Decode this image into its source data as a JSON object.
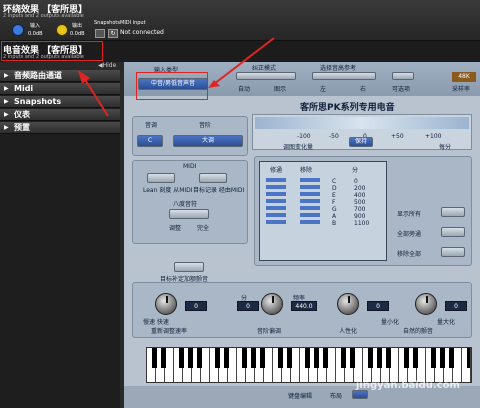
{
  "header": {
    "title1": "环绕效果 【客所思】",
    "subtitle1": "2 inputs and 2 outputs available",
    "input_label": "输入",
    "input_db": "0.0dB",
    "output_label": "输出",
    "output_db": "0.0dB",
    "snapshots_label": "Snapshots",
    "midi_input_label": "MIDI input",
    "midi_status": "Not connected",
    "title2": "电音效果 【客所思】",
    "subtitle2": "2 inputs and 2 outputs available",
    "hide_label": "◀Hide"
  },
  "sidebar": {
    "items": [
      {
        "label": "音频路由通道"
      },
      {
        "label": "Midi"
      },
      {
        "label": "Snapshots"
      },
      {
        "label": "仪表"
      },
      {
        "label": "预置"
      }
    ]
  },
  "plugin": {
    "input_type_label": "输入类型",
    "input_type_value": "中音/男低音声音",
    "correction_mode_label": "纠正模式",
    "auto_label": "自动",
    "graph_label": "图示",
    "select_pitch_label": "选择音高参考",
    "left_label": "左",
    "right_label": "右",
    "optional_label": "可选项",
    "sample_rate_value": "48K",
    "sample_rate_label": "采样率",
    "title": "客所思PK系列专用电音",
    "key_label": "音调",
    "key_value": "C",
    "scale_label": "音阶",
    "scale_value": "大调",
    "scale_ticks": [
      "-100",
      "-50",
      "0",
      "+50",
      "+100"
    ],
    "pitch_change_label": "调图变化量",
    "cents_label": "每分",
    "correct_btn": "保持",
    "midi_label": "MIDI",
    "learn_btn": "Lean 刻度 从MIDI",
    "target_btn": "目标记录 经由MIDI",
    "bend_label": "八度音符",
    "bend_sub1": "调整",
    "bend_sub2": "完全",
    "table_headers": [
      "修通",
      "移除",
      "分"
    ],
    "notes": [
      "C",
      "D",
      "E",
      "F",
      "G",
      "A",
      "B"
    ],
    "cents": [
      "0",
      "200",
      "400",
      "500",
      "700",
      "900",
      "1100"
    ],
    "show_all": "显示所有",
    "all_bypass": "全部旁通",
    "remove_all": "移除全部",
    "auto_bypass_label": "目标补定加额颤音",
    "knob1_label": "慢速  快速",
    "knob1_caption": "重新调整速率",
    "knob2_caption": "音阶偏调",
    "knob2_left": "0",
    "knob2_value": "440.0",
    "knob2_top": "分",
    "knob2_top2": "频率",
    "knob3_caption": "人性化",
    "knob4_caption": "自然的颤音",
    "knob4_left": "量小化",
    "knob4_right": "量大化",
    "val_knob1": "0",
    "val_knob3": "0",
    "val_knob4": "0",
    "keyboard_edit_label": "键盘编辑",
    "keyboard_mode_label": "布局"
  },
  "watermark": "jingyan.baidu.com",
  "colors": {
    "accent": "#e02424",
    "panel": "#b8c3cf",
    "knob_yellow": "#e8c51b",
    "knob_blue": "#3b7be0"
  }
}
